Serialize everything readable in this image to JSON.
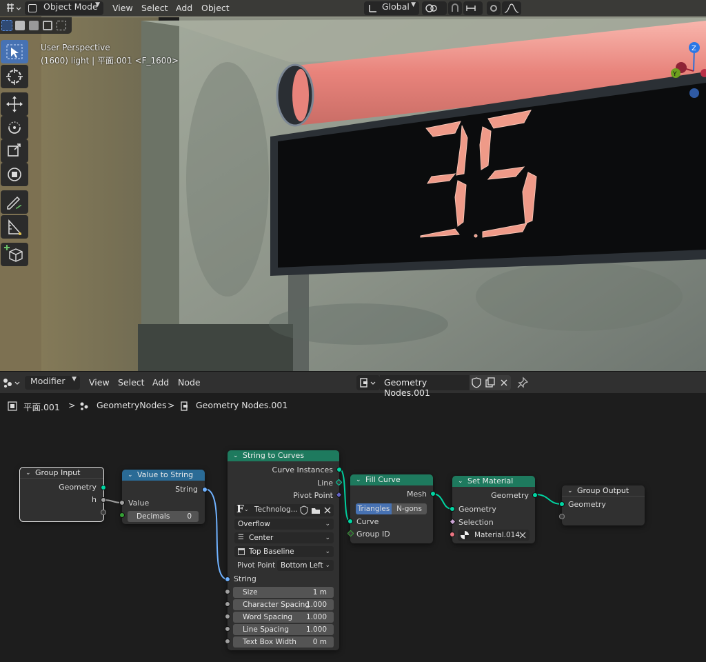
{
  "viewport": {
    "header": {
      "mode": "Object Mode",
      "menus": [
        "View",
        "Select",
        "Add",
        "Object"
      ],
      "orientation": "Global"
    },
    "info": {
      "line1": "User Perspective",
      "line2": "(1600) light | 平面.001 <F_1600>"
    },
    "gizmo": {
      "z": "Z",
      "y": "Y"
    },
    "display_digits": "35",
    "tools": [
      "select-box",
      "cursor",
      "move",
      "rotate",
      "scale",
      "transform",
      "annotate",
      "measure",
      "add-cube"
    ]
  },
  "node_editor": {
    "header": {
      "editor": "Modifier",
      "menus": [
        "View",
        "Select",
        "Add",
        "Node"
      ],
      "node_group": "Geometry Nodes.001"
    },
    "breadcrumb": [
      "平面.001",
      "GeometryNodes",
      "Geometry Nodes.001"
    ],
    "nodes": {
      "group_input": {
        "title": "Group Input",
        "outputs": [
          "Geometry",
          "h"
        ]
      },
      "value_to_string": {
        "title": "Value to String",
        "output": "String",
        "input": "Value",
        "decimals_label": "Decimals",
        "decimals_value": "0"
      },
      "string_to_curves": {
        "title": "String to Curves",
        "outputs": [
          "Curve Instances",
          "Line",
          "Pivot Point"
        ],
        "font": "Technolog...",
        "overflow": "Overflow",
        "align_x": "Center",
        "align_y": "Top Baseline",
        "pivot_label": "Pivot Point",
        "pivot_value": "Bottom Left",
        "string_label": "String",
        "fields": [
          {
            "label": "Size",
            "value": "1 m"
          },
          {
            "label": "Character Spacing",
            "value": "1.000"
          },
          {
            "label": "Word Spacing",
            "value": "1.000"
          },
          {
            "label": "Line Spacing",
            "value": "1.000"
          },
          {
            "label": "Text Box Width",
            "value": "0 m"
          }
        ]
      },
      "fill_curve": {
        "title": "Fill Curve",
        "output": "Mesh",
        "mode_a": "Triangles",
        "mode_b": "N-gons",
        "inputs": [
          "Curve",
          "Group ID"
        ]
      },
      "set_material": {
        "title": "Set Material",
        "output": "Geometry",
        "inputs": [
          "Geometry",
          "Selection"
        ],
        "material": "Material.014"
      },
      "group_output": {
        "title": "Group Output",
        "input": "Geometry"
      }
    }
  },
  "colors": {
    "accent": "#4772b3",
    "geometry_header": "#1e7a5e",
    "string_header": "#2a6b96",
    "geometry_socket": "#00d6a3",
    "string_socket": "#70b2ff"
  }
}
